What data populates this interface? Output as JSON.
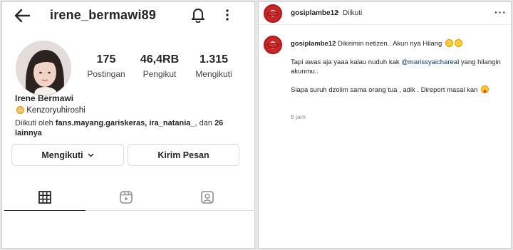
{
  "profile": {
    "username": "irene_bermawi89",
    "stats": [
      {
        "num": "175",
        "label": "Postingan"
      },
      {
        "num": "46,4RB",
        "label": "Pengikut"
      },
      {
        "num": "1.315",
        "label": "Mengikuti"
      }
    ],
    "full_name": "Irene Bermawi",
    "bio": "Kenzoryuhiroshi",
    "followed_by_prefix": "Diikuti oleh ",
    "followed_by_names": "fans.mayang.gariskeras, ira_natania_",
    "followed_by_mid": ", dan ",
    "followed_by_count": "26 lainnya",
    "btn_following": "Mengikuti",
    "btn_message": "Kirim Pesan",
    "icons": {
      "back": "back-arrow-icon",
      "bell": "bell-icon",
      "more": "kebab-menu-icon"
    }
  },
  "post": {
    "author": "gosiplambe12",
    "separator": "•",
    "follow_status": "Diikuti",
    "more": "···",
    "line1": "Dikirimin netizen.. Akun nya Hilang",
    "line2_pre": "Tapi awas aja yaaa kalau nuduh kak ",
    "mention": "@marissyaichareal",
    "line2_post": " yang hilangin akunmu..",
    "line3": "Siapa suruh dzolim sama orang tua , adik . Direport masal kan",
    "time": "6 jam"
  },
  "colors": {
    "mention": "#00376b",
    "avatar_ring": "#b0161b"
  }
}
